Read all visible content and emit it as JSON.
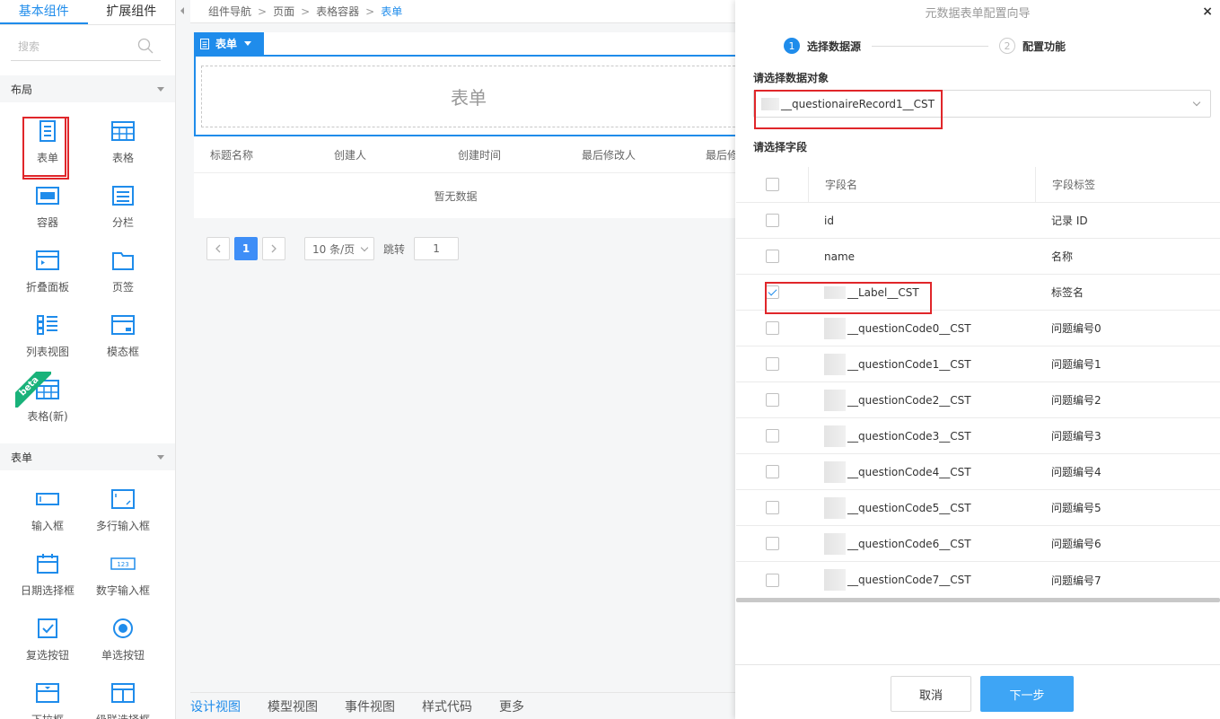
{
  "left_panel": {
    "tabs": [
      {
        "label": "基本组件"
      },
      {
        "label": "扩展组件"
      }
    ],
    "search_placeholder": "搜索",
    "section_layout": "布局",
    "layout_items": [
      {
        "label": "表单",
        "icon": "form-icon"
      },
      {
        "label": "表格",
        "icon": "table-icon"
      },
      {
        "label": "容器",
        "icon": "container-icon"
      },
      {
        "label": "分栏",
        "icon": "columns-icon"
      },
      {
        "label": "折叠面板",
        "icon": "collapse-panel-icon"
      },
      {
        "label": "页签",
        "icon": "tabs-icon"
      },
      {
        "label": "列表视图",
        "icon": "list-view-icon"
      },
      {
        "label": "模态框",
        "icon": "modal-icon"
      },
      {
        "label": "表格(新)",
        "icon": "table-new-icon",
        "badge": "beta"
      }
    ],
    "section_form": "表单",
    "form_items": [
      {
        "label": "输入框",
        "icon": "input-icon"
      },
      {
        "label": "多行输入框",
        "icon": "textarea-icon"
      },
      {
        "label": "日期选择框",
        "icon": "date-picker-icon"
      },
      {
        "label": "数字输入框",
        "icon": "number-input-icon"
      },
      {
        "label": "复选按钮",
        "icon": "checkbox-icon"
      },
      {
        "label": "单选按钮",
        "icon": "radio-icon"
      },
      {
        "label": "下拉框",
        "icon": "dropdown-icon"
      },
      {
        "label": "级联选择框",
        "icon": "cascader-icon"
      }
    ]
  },
  "breadcrumb": {
    "items": [
      {
        "label": "组件导航"
      },
      {
        "label": "页面"
      },
      {
        "label": "表格容器"
      },
      {
        "label": "表单"
      }
    ]
  },
  "canvas": {
    "form_tag": "表单",
    "form_placeholder": "表单",
    "table_headers": [
      "标题名称",
      "创建人",
      "创建时间",
      "最后修改人",
      "最后修"
    ],
    "empty_text": "暂无数据",
    "pager": {
      "current_page": "1",
      "page_size": "10 条/页",
      "jump_label": "跳转",
      "jump_value": "1"
    }
  },
  "bottom_tabs": [
    {
      "label": "设计视图"
    },
    {
      "label": "模型视图"
    },
    {
      "label": "事件视图"
    },
    {
      "label": "样式代码"
    },
    {
      "label": "更多"
    }
  ],
  "wizard": {
    "title": "元数据表单配置向导",
    "close": "×",
    "steps": [
      {
        "num": "1",
        "label": "选择数据源"
      },
      {
        "num": "2",
        "label": "配置功能"
      }
    ],
    "data_object_label": "请选择数据对象",
    "data_object_value": "__questionaireRecord1__CST",
    "field_label": "请选择字段",
    "columns": [
      "字段名",
      "字段标签"
    ],
    "fields": [
      {
        "name": "id",
        "label": "记录 ID",
        "checked": false
      },
      {
        "name": "name",
        "label": "名称",
        "checked": false
      },
      {
        "name": "__Label__CST",
        "label": "标签名",
        "checked": true
      },
      {
        "name": "__questionCode0__CST",
        "label": "问题编号0",
        "checked": false
      },
      {
        "name": "__questionCode1__CST",
        "label": "问题编号1",
        "checked": false
      },
      {
        "name": "__questionCode2__CST",
        "label": "问题编号2",
        "checked": false
      },
      {
        "name": "__questionCode3__CST",
        "label": "问题编号3",
        "checked": false
      },
      {
        "name": "__questionCode4__CST",
        "label": "问题编号4",
        "checked": false
      },
      {
        "name": "__questionCode5__CST",
        "label": "问题编号5",
        "checked": false
      },
      {
        "name": "__questionCode6__CST",
        "label": "问题编号6",
        "checked": false
      },
      {
        "name": "__questionCode7__CST",
        "label": "问题编号7",
        "checked": false
      }
    ],
    "cancel_label": "取消",
    "next_label": "下一步"
  },
  "colors": {
    "accent": "#1f8ceb",
    "highlight": "#e0262a",
    "primary_button": "#3ea5f5"
  }
}
